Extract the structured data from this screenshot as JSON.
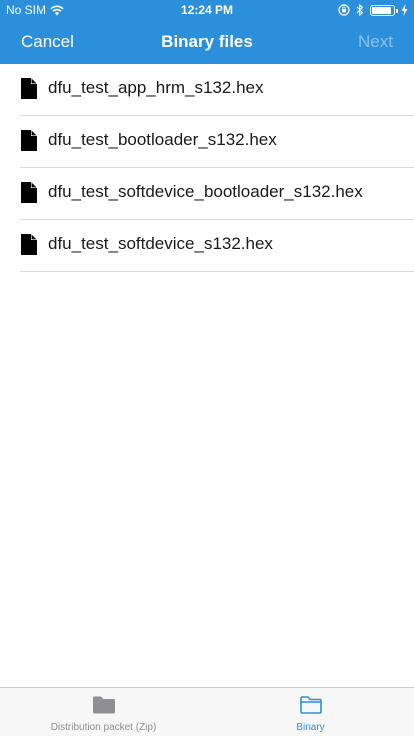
{
  "status_bar": {
    "carrier": "No SIM",
    "time": "12:24 PM",
    "battery_level": 0.9
  },
  "nav": {
    "cancel_label": "Cancel",
    "title": "Binary files",
    "next_label": "Next"
  },
  "files": [
    {
      "name": "dfu_test_app_hrm_s132.hex",
      "icon": "document-icon"
    },
    {
      "name": "dfu_test_bootloader_s132.hex",
      "icon": "document-icon"
    },
    {
      "name": "dfu_test_softdevice_bootloader_s132.hex",
      "icon": "document-icon"
    },
    {
      "name": "dfu_test_softdevice_s132.hex",
      "icon": "document-icon"
    }
  ],
  "tabs": [
    {
      "label": "Distribution packet (Zip)",
      "icon": "folder-filled-icon",
      "active": false
    },
    {
      "label": "Binary",
      "icon": "folder-outline-icon",
      "active": true
    }
  ],
  "colors": {
    "accent": "#2b8fdc",
    "inactive_tab": "#8e8e93",
    "separator": "#d9d9de"
  }
}
